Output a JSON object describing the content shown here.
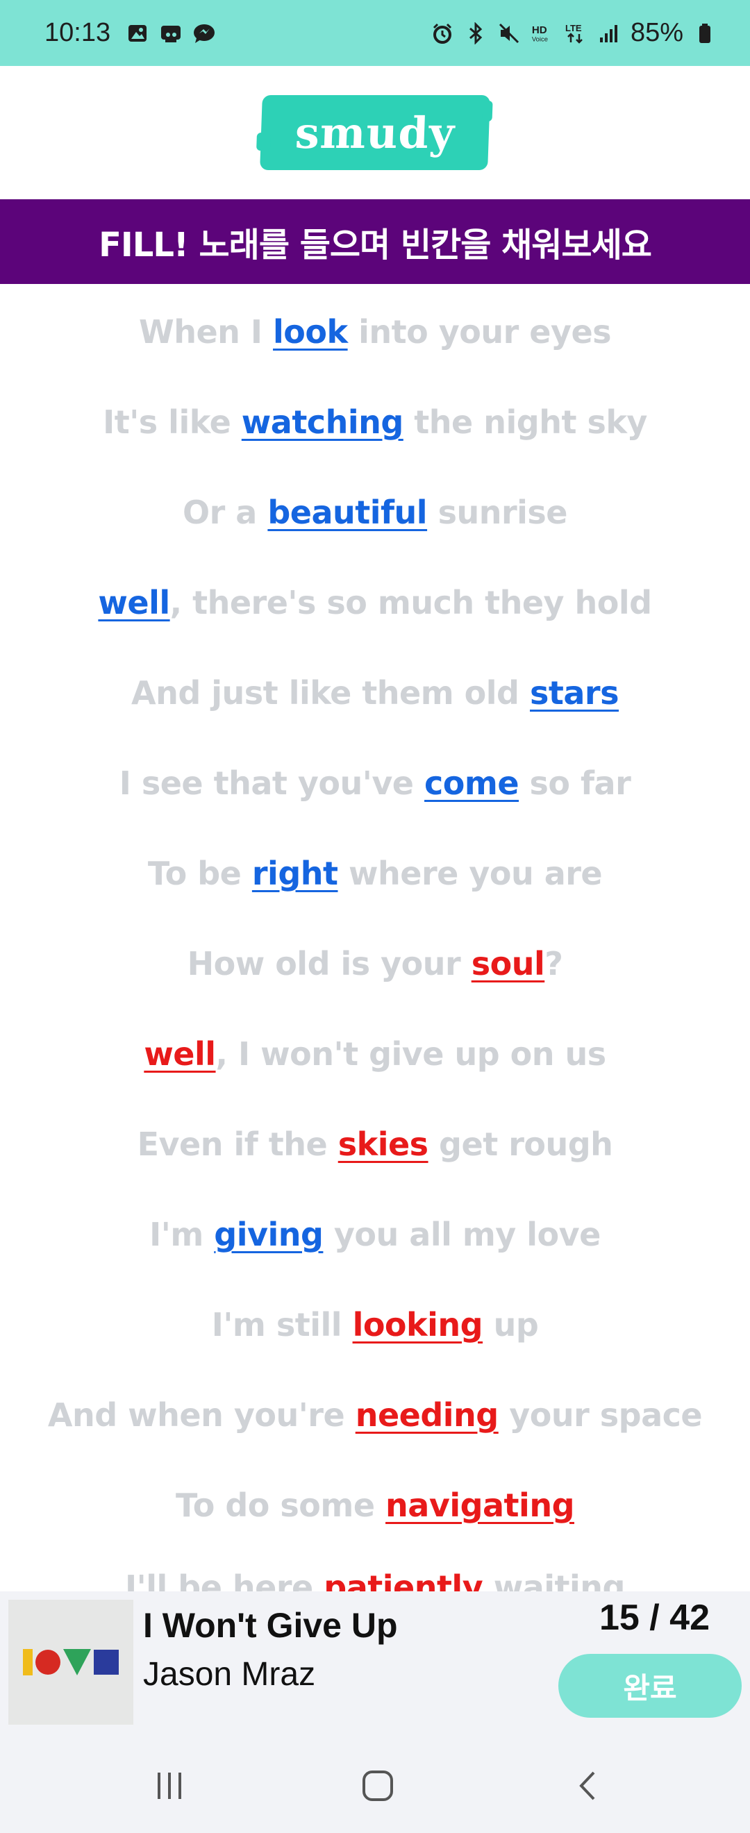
{
  "status_bar": {
    "time": "10:13",
    "battery": "85%",
    "left_icons": [
      "image-icon",
      "cast-icon",
      "messenger-icon"
    ],
    "right_icons": [
      "alarm-icon",
      "bluetooth-icon",
      "mute-icon",
      "hd-voice-icon",
      "lte-icon",
      "signal-icon",
      "battery-icon"
    ]
  },
  "header": {
    "logo_text": "smudy"
  },
  "banner": {
    "text": "FILL! 노래를 들으며 빈칸을 채워보세요"
  },
  "lyrics": [
    {
      "before": "When I ",
      "word": "look",
      "after": " into your eyes",
      "word_color": "blue"
    },
    {
      "before": "It's like ",
      "word": "watching",
      "after": " the night sky",
      "word_color": "blue"
    },
    {
      "before": "Or a ",
      "word": "beautiful",
      "after": " sunrise",
      "word_color": "blue"
    },
    {
      "before": "",
      "word": "well",
      "after": ", there's so much they hold",
      "word_color": "blue"
    },
    {
      "before": "And just like them old ",
      "word": "stars",
      "after": "",
      "word_color": "blue"
    },
    {
      "before": "I see that you've ",
      "word": "come",
      "after": " so far",
      "word_color": "blue"
    },
    {
      "before": "To be ",
      "word": "right",
      "after": " where you are",
      "word_color": "blue"
    },
    {
      "before": "How old is your ",
      "word": "soul",
      "after": "?",
      "word_color": "red"
    },
    {
      "before": "",
      "word": "well",
      "after": ", I won't give up on us",
      "word_color": "red"
    },
    {
      "before": "Even if the ",
      "word": "skies",
      "after": " get rough",
      "word_color": "red"
    },
    {
      "before": "I'm ",
      "word": "giving",
      "after": " you all my love",
      "word_color": "blue"
    },
    {
      "before": "I'm still ",
      "word": "looking",
      "after": " up",
      "word_color": "red"
    },
    {
      "before": "And when you're ",
      "word": "needing",
      "after": " your space",
      "word_color": "red"
    },
    {
      "before": "To do some ",
      "word": "navigating",
      "after": "",
      "word_color": "red"
    },
    {
      "before": "I'll be here ",
      "word": "patiently",
      "after": " waiting",
      "word_color": "red"
    }
  ],
  "player": {
    "song_title": "I Won't Give Up",
    "artist": "Jason Mraz",
    "progress_text": "15 / 42",
    "done_label": "완료"
  },
  "colors": {
    "accent_teal": "#7ee3d4",
    "banner_purple": "#5c047a",
    "word_blue": "#1565e0",
    "word_red": "#e81a1a",
    "lyric_gray": "#cfd2d6"
  }
}
